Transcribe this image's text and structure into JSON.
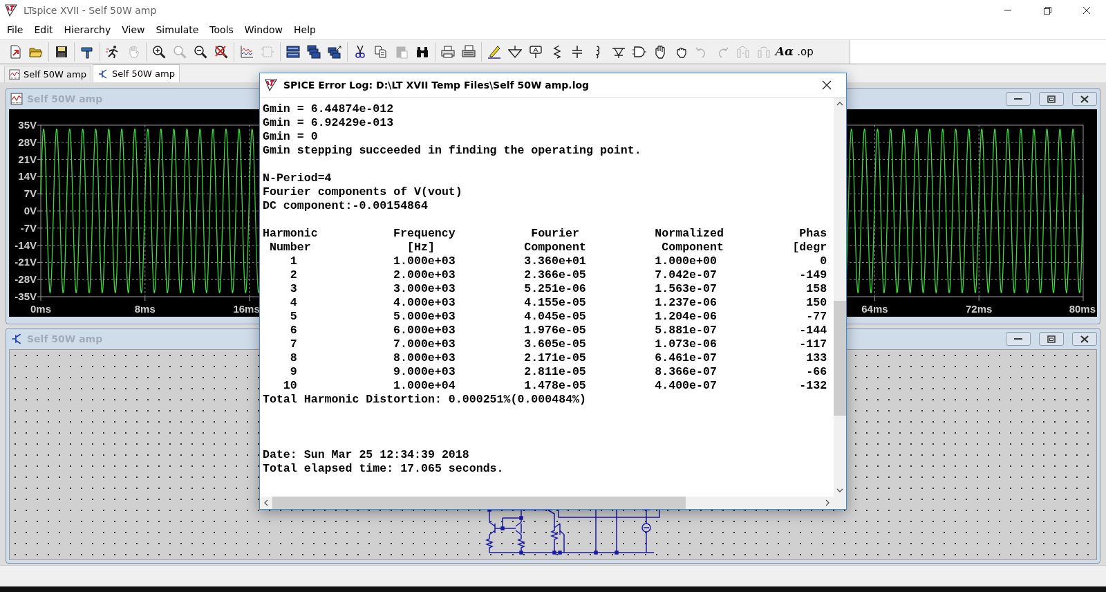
{
  "window": {
    "title": "LTspice XVII - Self 50W amp"
  },
  "menu": [
    "File",
    "Edit",
    "Hierarchy",
    "View",
    "Simulate",
    "Tools",
    "Window",
    "Help"
  ],
  "toolbar_groups": [
    [
      {
        "kind": "new",
        "disabled": false
      },
      {
        "kind": "open",
        "disabled": false
      }
    ],
    [
      {
        "kind": "save",
        "disabled": false
      }
    ],
    [
      {
        "kind": "hammer",
        "disabled": false
      }
    ],
    [
      {
        "kind": "run",
        "disabled": false
      },
      {
        "kind": "halt",
        "disabled": true
      }
    ],
    [
      {
        "kind": "zoomin",
        "disabled": false
      },
      {
        "kind": "zoomfull",
        "disabled": true
      },
      {
        "kind": "zoomout",
        "disabled": false
      },
      {
        "kind": "zoomcancel",
        "disabled": false
      }
    ],
    [
      {
        "kind": "waveform",
        "disabled": false
      },
      {
        "kind": "component",
        "disabled": true
      }
    ],
    [
      {
        "kind": "tile",
        "disabled": false
      },
      {
        "kind": "cascade",
        "disabled": false
      },
      {
        "kind": "cascade2",
        "disabled": false
      }
    ],
    [
      {
        "kind": "cut",
        "disabled": false
      },
      {
        "kind": "copy",
        "disabled": false
      },
      {
        "kind": "paste",
        "disabled": true
      },
      {
        "kind": "find",
        "disabled": false
      }
    ],
    [
      {
        "kind": "print",
        "disabled": false
      },
      {
        "kind": "printsetup",
        "disabled": false
      }
    ],
    [
      {
        "kind": "wire",
        "disabled": false
      },
      {
        "kind": "ground",
        "disabled": false
      },
      {
        "kind": "label",
        "disabled": false
      },
      {
        "kind": "resistor",
        "disabled": false
      },
      {
        "kind": "capacitor",
        "disabled": false
      },
      {
        "kind": "inductor",
        "disabled": false
      },
      {
        "kind": "diode",
        "disabled": false
      },
      {
        "kind": "gate",
        "disabled": false
      },
      {
        "kind": "move",
        "disabled": false
      },
      {
        "kind": "drag",
        "disabled": false
      },
      {
        "kind": "undo",
        "disabled": true
      },
      {
        "kind": "redo",
        "disabled": true
      },
      {
        "kind": "rotate",
        "disabled": true
      },
      {
        "kind": "mirror",
        "disabled": true
      },
      {
        "kind": "text",
        "label": "Aα",
        "disabled": false
      },
      {
        "kind": "text",
        "label": ".op",
        "disabled": false
      }
    ]
  ],
  "tabs": [
    {
      "label": "Self 50W amp",
      "kind": "waveform",
      "selected": false
    },
    {
      "label": "Self 50W amp",
      "kind": "schematic",
      "selected": true
    }
  ],
  "plot_window": {
    "title": "Self 50W amp",
    "y_ticks": [
      "35V",
      "28V",
      "21V",
      "14V",
      "7V",
      "0V",
      "-7V",
      "-14V",
      "-21V",
      "-28V",
      "-35V"
    ],
    "x_ticks": [
      "0ms",
      "8ms",
      "16ms",
      "64ms",
      "72ms",
      "80ms"
    ]
  },
  "schematic_window": {
    "title": "Self 50W amp"
  },
  "error_log": {
    "title": "SPICE Error Log: D:\\LT XVII Temp Files\\Self 50W amp.log",
    "gmin_lines": [
      "Gmin = 6.44874e-012",
      "Gmin = 6.92429e-013",
      "Gmin = 0",
      "Gmin stepping succeeded in finding the operating point."
    ],
    "fourier_lines": [
      "N-Period=4",
      "Fourier components of V(vout)",
      "DC component:-0.00154864"
    ],
    "table": {
      "header_1": [
        "Harmonic",
        "Frequency",
        "Fourier",
        "Normalized",
        "Phas"
      ],
      "header_2": [
        "Number",
        "[Hz]",
        "Component",
        "Component",
        "[degr"
      ],
      "rows": [
        [
          "1",
          "1.000e+03",
          "3.360e+01",
          "1.000e+00",
          "0"
        ],
        [
          "2",
          "2.000e+03",
          "2.366e-05",
          "7.042e-07",
          "-149"
        ],
        [
          "3",
          "3.000e+03",
          "5.251e-06",
          "1.563e-07",
          "158"
        ],
        [
          "4",
          "4.000e+03",
          "4.155e-05",
          "1.237e-06",
          "150"
        ],
        [
          "5",
          "5.000e+03",
          "4.045e-05",
          "1.204e-06",
          "-77"
        ],
        [
          "6",
          "6.000e+03",
          "1.976e-05",
          "5.881e-07",
          "-144"
        ],
        [
          "7",
          "7.000e+03",
          "3.605e-05",
          "1.073e-06",
          "-117"
        ],
        [
          "8",
          "8.000e+03",
          "2.171e-05",
          "6.461e-07",
          "133"
        ],
        [
          "9",
          "9.000e+03",
          "2.811e-05",
          "8.366e-07",
          "-66"
        ],
        [
          "10",
          "1.000e+04",
          "1.478e-05",
          "4.400e-07",
          "-132"
        ]
      ]
    },
    "thd": "Total Harmonic Distortion: 0.000251%(0.000484%)",
    "footer_lines": [
      "Date: Sun Mar 25 12:34:39 2018",
      "Total elapsed time: 17.065 seconds."
    ]
  }
}
